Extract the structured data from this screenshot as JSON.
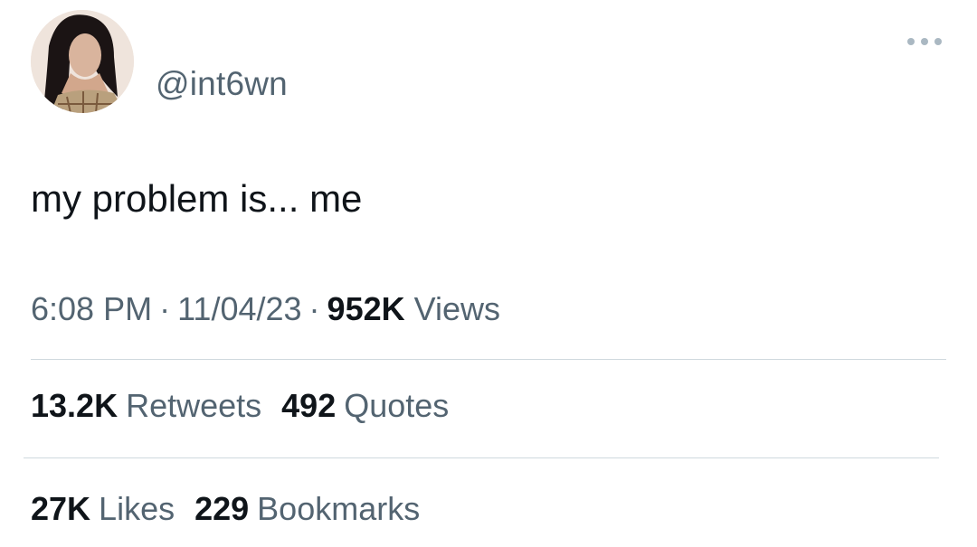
{
  "tweet": {
    "handle": "@int6wn",
    "text": "my problem is... me",
    "time": "6:08 PM",
    "date": "11/04/23",
    "separator": "·",
    "views_count": "952K",
    "views_label": "Views"
  },
  "stats": {
    "retweets": {
      "count": "13.2K",
      "label": "Retweets"
    },
    "quotes": {
      "count": "492",
      "label": "Quotes"
    },
    "likes": {
      "count": "27K",
      "label": "Likes"
    },
    "bookmarks": {
      "count": "229",
      "label": "Bookmarks"
    }
  },
  "icons": {
    "more": "more-dots-icon"
  },
  "colors": {
    "text_primary": "#0f1419",
    "text_secondary": "#536471",
    "divider": "#cfd9de"
  }
}
